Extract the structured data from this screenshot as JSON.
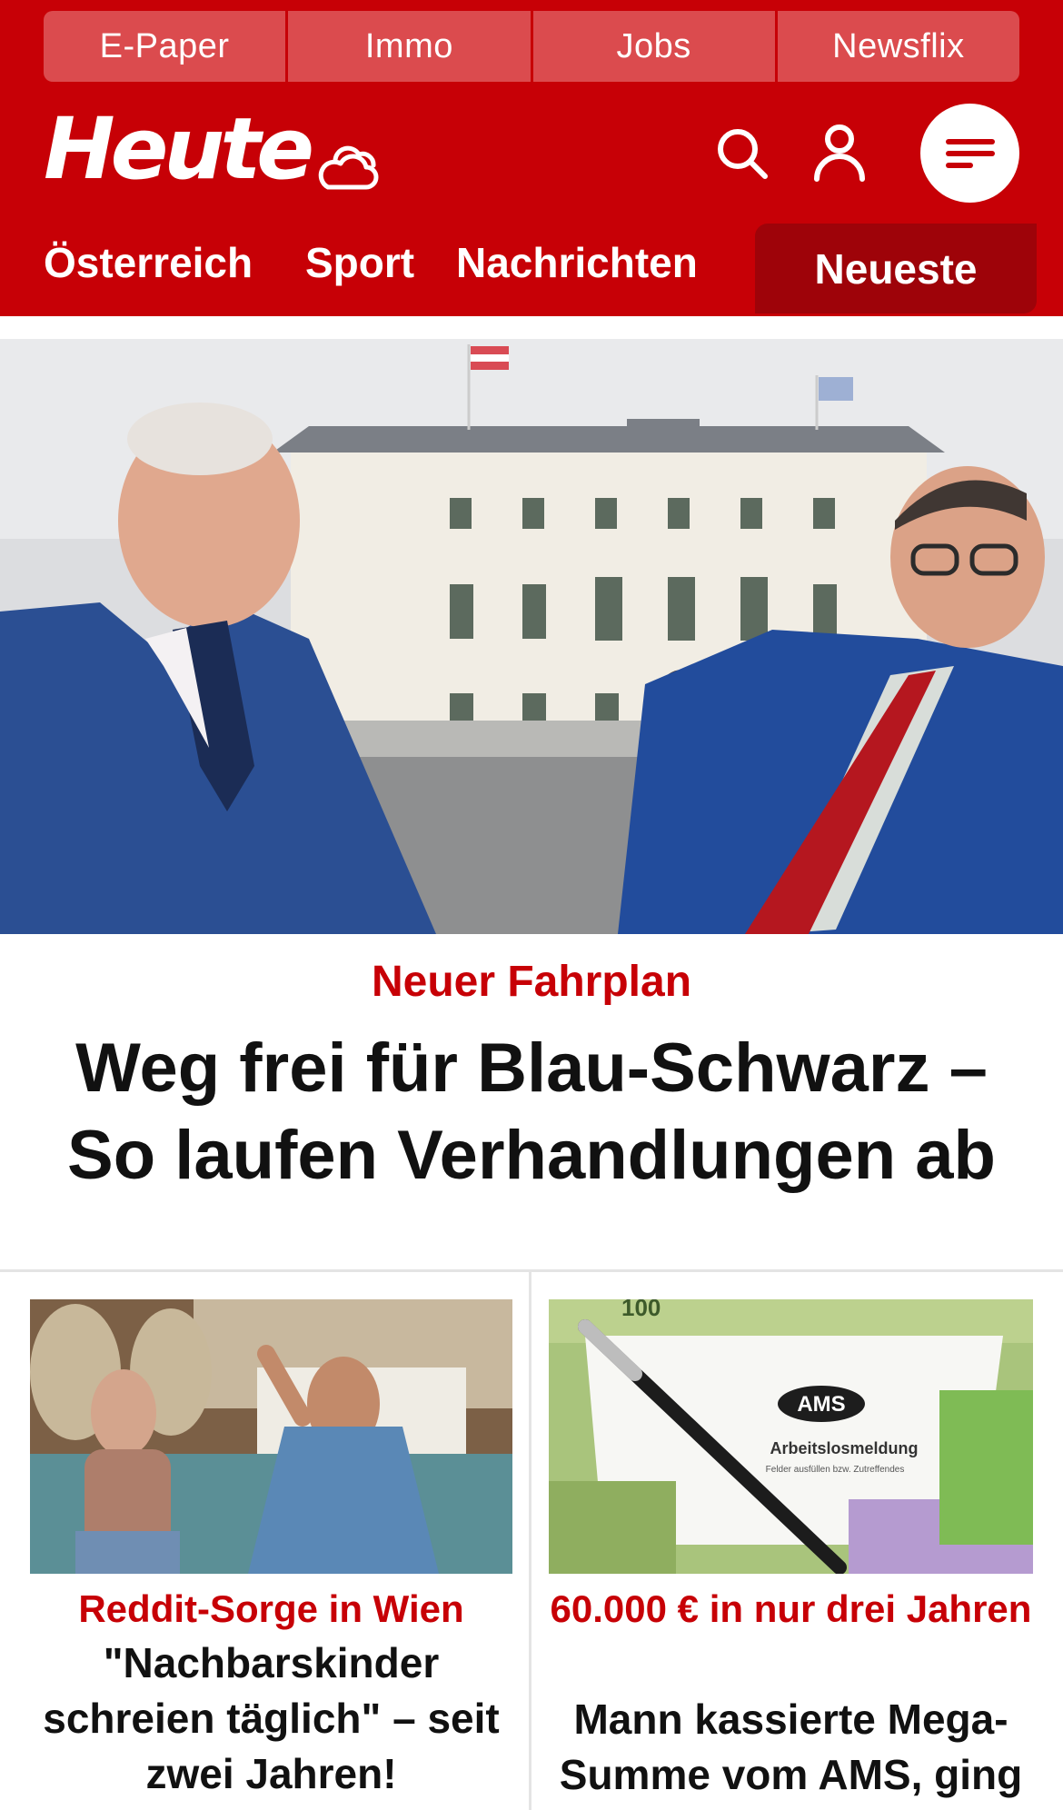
{
  "topbar": {
    "items": [
      "E-Paper",
      "Immo",
      "Jobs",
      "Newsflix"
    ]
  },
  "header": {
    "logo": "Heute",
    "icons": {
      "weather": "weather-cloud-icon",
      "search": "search-icon",
      "user": "user-icon",
      "menu": "menu-icon"
    }
  },
  "nav": {
    "items": [
      "Österreich",
      "Sport",
      "Nachrichten"
    ],
    "highlight": "Neueste"
  },
  "hero": {
    "kicker": "Neuer Fahrplan",
    "headline": "Weg frei für Blau-Schwarz – So laufen Verhandlungen ab"
  },
  "teasers": [
    {
      "kicker": "Reddit-Sorge in Wien",
      "headline": "\"Nachbarskinder schreien täglich\" – seit zwei Jahren!"
    },
    {
      "kicker": "60.000 € in nur drei Jahren",
      "headline": "Mann kassierte Mega-Summe vom AMS, ging",
      "image_text": {
        "brand": "AMS",
        "form": "Arbeitslosmeldung",
        "form_sub": "Felder ausfüllen bzw. Zutreffendes",
        "banknote_value": "100"
      }
    }
  ],
  "colors": {
    "brand_red": "#c70006",
    "topbar_button": "#db4b4e",
    "nav_active": "#9e0309"
  }
}
